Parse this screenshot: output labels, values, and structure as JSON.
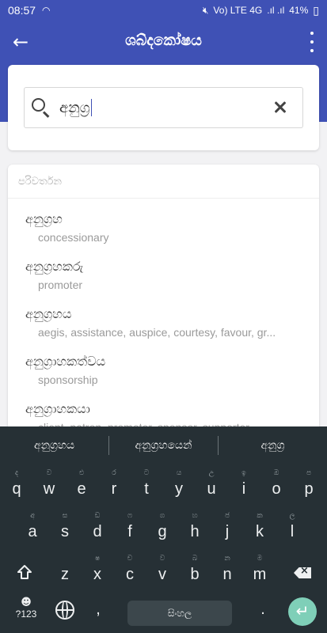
{
  "status": {
    "time": "08:57",
    "wifi_icon": "wifi-icon",
    "network": "Vo) LTE 4G",
    "signal": ".ıl .ıl",
    "battery": "41%"
  },
  "appbar": {
    "title": "ශබ්දකෝෂය",
    "back_icon": "arrow-left-icon",
    "menu_icon": "more-vertical-icon"
  },
  "search": {
    "value": "අනුග්‍ර",
    "search_icon": "search-icon",
    "clear_icon": "close-icon"
  },
  "results": {
    "header": "පරිවර්තන",
    "items": [
      {
        "word": "අනුග්‍රහ",
        "meaning": "concessionary"
      },
      {
        "word": "අනුග්‍රහකරු",
        "meaning": "promoter"
      },
      {
        "word": "අනුග්‍රහය",
        "meaning": "aegis, assistance, auspice, courtesy, favour, gr..."
      },
      {
        "word": "අනුග්‍රාහකත්වය",
        "meaning": "sponsorship"
      },
      {
        "word": "අනුග්‍රාහකයා",
        "meaning": "client, patron, promoter, sponsor, supporter"
      }
    ]
  },
  "keyboard": {
    "suggestions": [
      "අනුග්‍රහය",
      "අනුග්‍රහයෙන්",
      "අනුග්‍ර"
    ],
    "row1": [
      {
        "k": "q",
        "h": "ද"
      },
      {
        "k": "w",
        "h": "ව"
      },
      {
        "k": "e",
        "h": "එ"
      },
      {
        "k": "r",
        "h": "ර"
      },
      {
        "k": "t",
        "h": "ට"
      },
      {
        "k": "y",
        "h": "ය"
      },
      {
        "k": "u",
        "h": "උ"
      },
      {
        "k": "i",
        "h": "ඉ"
      },
      {
        "k": "o",
        "h": "ඔ"
      },
      {
        "k": "p",
        "h": "ප"
      }
    ],
    "row2": [
      {
        "k": "a",
        "h": "අ"
      },
      {
        "k": "s",
        "h": "ස"
      },
      {
        "k": "d",
        "h": "ඩ"
      },
      {
        "k": "f",
        "h": "ෆ"
      },
      {
        "k": "g",
        "h": "ග"
      },
      {
        "k": "h",
        "h": "හ"
      },
      {
        "k": "j",
        "h": "ජ"
      },
      {
        "k": "k",
        "h": "ක"
      },
      {
        "k": "l",
        "h": "ල"
      }
    ],
    "row3": [
      {
        "k": "z",
        "h": ""
      },
      {
        "k": "x",
        "h": "ෂ"
      },
      {
        "k": "c",
        "h": "ච"
      },
      {
        "k": "v",
        "h": "ව"
      },
      {
        "k": "b",
        "h": "බ"
      },
      {
        "k": "n",
        "h": "න"
      },
      {
        "k": "m",
        "h": "ම"
      }
    ],
    "emoji_label": "?123",
    "comma": ",",
    "space_label": "සිංහල",
    "period": ".",
    "enter_icon": "enter-arrow-icon",
    "shift_icon": "shift-icon",
    "backspace_icon": "backspace-icon",
    "globe_icon": "globe-icon"
  }
}
